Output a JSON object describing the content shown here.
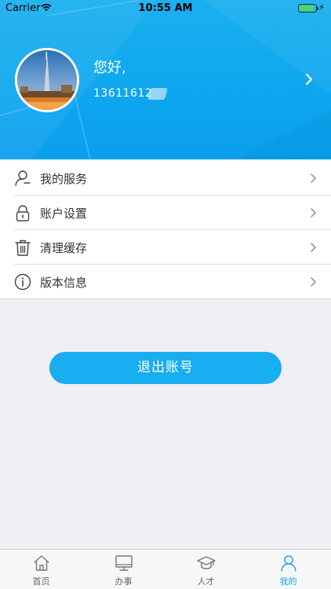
{
  "status_bar": {
    "carrier": "Carrier",
    "time": "10:55 AM",
    "bolt": "⚡"
  },
  "profile": {
    "greeting": "您好,",
    "phone": "13611612"
  },
  "menu": {
    "items": [
      {
        "label": "我的服务",
        "icon": "person-icon"
      },
      {
        "label": "账户设置",
        "icon": "lock-icon"
      },
      {
        "label": "清理缓存",
        "icon": "trash-icon"
      },
      {
        "label": "版本信息",
        "icon": "info-icon"
      }
    ]
  },
  "logout": {
    "label": "退出账号"
  },
  "tab_bar": {
    "tabs": [
      {
        "label": "首页",
        "icon": "home-icon",
        "active": false
      },
      {
        "label": "办事",
        "icon": "monitor-icon",
        "active": false
      },
      {
        "label": "人才",
        "icon": "graduation-cap-icon",
        "active": false
      },
      {
        "label": "我的",
        "icon": "person-icon",
        "active": true
      }
    ]
  },
  "colors": {
    "header_blue": "#0ea6ef",
    "accent": "#19adf2",
    "active_tab": "#1da5e8"
  }
}
